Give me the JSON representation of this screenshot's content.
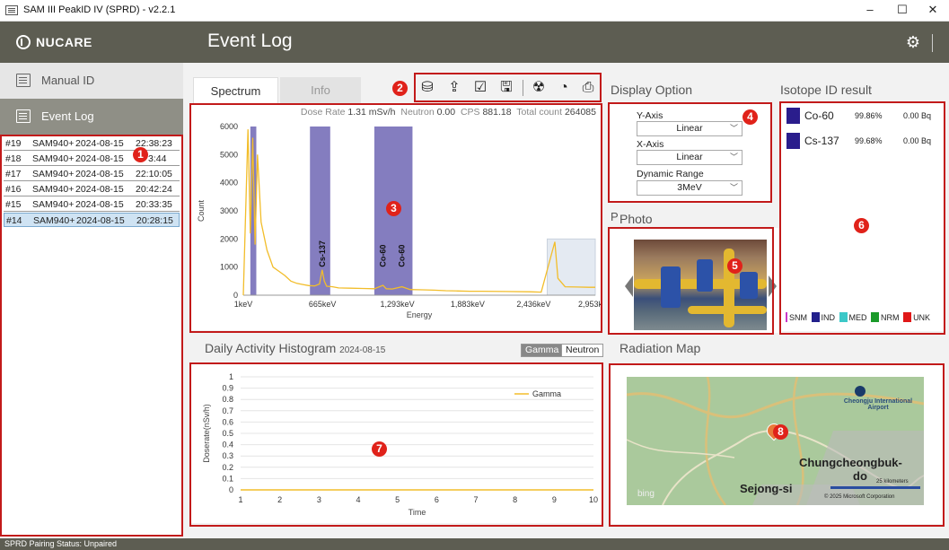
{
  "window": {
    "title": "SAM III PeakID IV (SPRD) - v2.2.1",
    "minimize": "–",
    "maximize": "☐",
    "close": "✕"
  },
  "brand": {
    "logo": "NUCARE"
  },
  "header": {
    "title": "Event Log",
    "settings_icon": "gear-icon"
  },
  "sidebar": {
    "items": [
      {
        "label": "Manual ID",
        "icon": "manual-id-icon"
      },
      {
        "label": "Event Log",
        "icon": "calendar-icon"
      }
    ]
  },
  "events": [
    {
      "id": "#19",
      "device": "SAM940+",
      "date": "2024-08-15",
      "time": "22:38:23"
    },
    {
      "id": "#18",
      "device": "SAM940+",
      "date": "2024-08-15",
      "time": "3:44"
    },
    {
      "id": "#17",
      "device": "SAM940+",
      "date": "2024-08-15",
      "time": "22:10:05"
    },
    {
      "id": "#16",
      "device": "SAM940+",
      "date": "2024-08-15",
      "time": "20:42:24"
    },
    {
      "id": "#15",
      "device": "SAM940+",
      "date": "2024-08-15",
      "time": "20:33:35"
    },
    {
      "id": "#14",
      "device": "SAM940+",
      "date": "2024-08-15",
      "time": "20:28:15",
      "selected": true
    }
  ],
  "tabs": [
    {
      "label": "Spectrum",
      "active": true
    },
    {
      "label": "Info",
      "active": false
    }
  ],
  "toolbar_icons": [
    "database-icon",
    "upload-icon",
    "edit-check-icon",
    "save-icon",
    "radiation-icon",
    "history-icon",
    "print-icon"
  ],
  "spectrum": {
    "stats_dose_label": "Dose Rate",
    "stats_dose_value": "1.31 mSv/h",
    "stats_neutron_label": "Neutron",
    "stats_neutron_value": "0.00",
    "stats_cps_label": "CPS",
    "stats_cps_value": "881.18",
    "stats_total_label": "Total count",
    "stats_total_value": "264085"
  },
  "display_option": {
    "title": "Display Option",
    "y_axis_label": "Y-Axis",
    "y_axis_value": "Linear",
    "x_axis_label": "X-Axis",
    "x_axis_value": "Linear",
    "dynamic_range_label": "Dynamic Range",
    "dynamic_range_value": "3MeV"
  },
  "isotope": {
    "title": "Isotope ID result",
    "results": [
      {
        "name": "Co-60",
        "confidence": "99.86%",
        "activity": "0.00 Bq",
        "color": "#2a1d8c"
      },
      {
        "name": "Cs-137",
        "confidence": "99.68%",
        "activity": "0.00 Bq",
        "color": "#2a1d8c"
      }
    ],
    "legend": [
      {
        "label": "SNM",
        "color": "#c837c8"
      },
      {
        "label": "IND",
        "color": "#22208c"
      },
      {
        "label": "MED",
        "color": "#3cc8c8"
      },
      {
        "label": "NRM",
        "color": "#1a9a2a"
      },
      {
        "label": "UNK",
        "color": "#e01818"
      }
    ]
  },
  "photo": {
    "title": "Photo",
    "hidden_letter": "P"
  },
  "histogram": {
    "title": "Daily Activity Histogram",
    "date": "2024-08-15",
    "toggle_gamma": "Gamma",
    "toggle_neutron": "Neutron"
  },
  "map": {
    "title": "Radiation Map",
    "label_city": "Chungcheongbuk-",
    "label_city2": "do",
    "label_sejong": "Sejong-si",
    "label_airport": "Cheongju International Airport",
    "scale": "25 kilometers",
    "copyright": "© 2025 Microsoft Corporation",
    "bing": "bing"
  },
  "status": {
    "pairing": "SPRD Pairing Status:  Unpaired"
  },
  "callouts": [
    "1",
    "2",
    "3",
    "4",
    "5",
    "6",
    "7",
    "8"
  ],
  "chart_data": [
    {
      "type": "line",
      "xlabel": "Energy",
      "ylabel": "Count",
      "x_ticks": [
        "1keV",
        "665keV",
        "1,293keV",
        "1,883keV",
        "2,436keV",
        "2,953keV"
      ],
      "y_ticks": [
        0,
        1000,
        2000,
        3000,
        4000,
        5000,
        6000
      ],
      "ylim": [
        0,
        6000
      ],
      "xlim": [
        1,
        2953
      ],
      "series": [
        {
          "x": [
            1,
            40,
            60,
            80,
            100,
            120,
            150,
            200,
            250,
            300,
            350,
            400,
            450,
            500,
            550,
            600,
            640,
            662,
            680,
            700,
            750,
            800,
            900,
            1000,
            1100,
            1173,
            1200,
            1250,
            1332,
            1400,
            1500,
            1600,
            1700,
            1800,
            1900,
            2000,
            2200,
            2400,
            2500,
            2614,
            2640,
            2700,
            2800,
            2900,
            2953
          ],
          "y": [
            0,
            5900,
            2200,
            5600,
            1800,
            5000,
            2600,
            1600,
            1000,
            850,
            700,
            500,
            420,
            380,
            340,
            330,
            400,
            900,
            500,
            320,
            300,
            260,
            250,
            240,
            230,
            350,
            230,
            220,
            300,
            200,
            190,
            180,
            160,
            150,
            140,
            140,
            130,
            120,
            110,
            1900,
            600,
            300,
            290,
            280,
            280
          ]
        }
      ],
      "highlight_bands_keV": [
        [
          60,
          110
        ],
        [
          560,
          730
        ],
        [
          1100,
          1420
        ]
      ],
      "peak_labels": [
        {
          "label": "Cs-137",
          "x": 662
        },
        {
          "label": "Co-60",
          "x": 1173
        },
        {
          "label": "Co-60",
          "x": 1332
        }
      ],
      "shaded_region_keV": [
        2550,
        2953
      ]
    },
    {
      "type": "line",
      "xlabel": "Time",
      "ylabel": "Doserate(nSv/h)",
      "x_ticks": [
        1,
        2,
        3,
        4,
        5,
        6,
        7,
        8,
        9,
        10
      ],
      "y_ticks": [
        0,
        0.1,
        0.2,
        0.3,
        0.4,
        0.5,
        0.6,
        0.7,
        0.8,
        0.9,
        1
      ],
      "ylim": [
        0,
        1
      ],
      "xlim": [
        1,
        10
      ],
      "series": [
        {
          "name": "Gamma",
          "x": [
            1,
            10
          ],
          "y": [
            0,
            0
          ]
        }
      ]
    }
  ]
}
